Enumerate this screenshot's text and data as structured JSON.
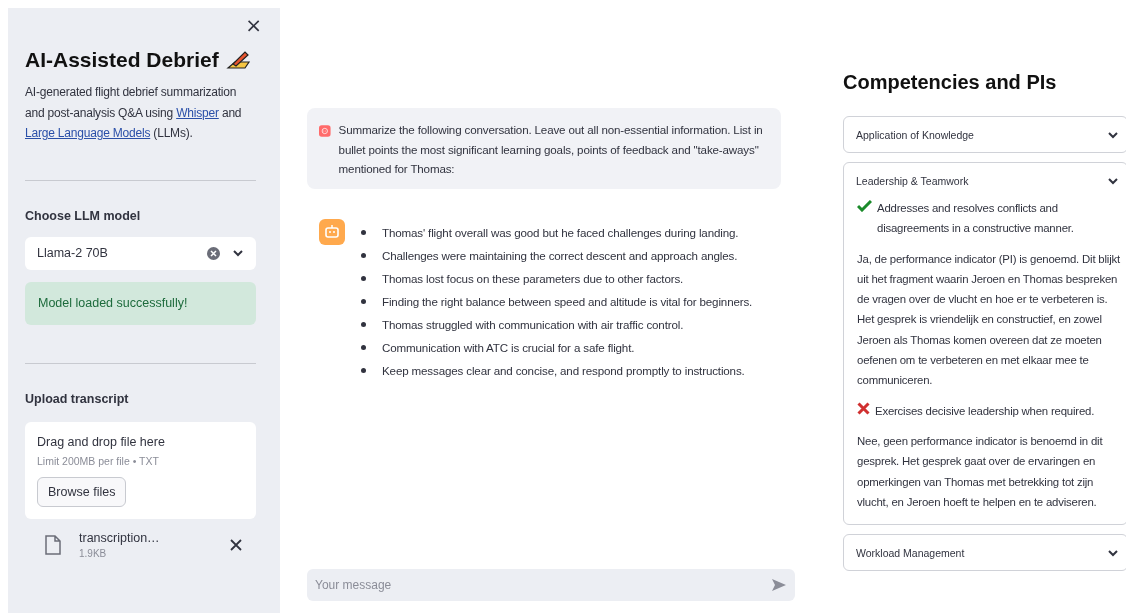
{
  "sidebar": {
    "close": "×",
    "title": "AI-Assisted Debrief",
    "description": "AI-generated flight debrief summarization and post-analysis Q&A using ",
    "links": [
      "Whisper",
      "Large Language Models"
    ],
    "description_joiner": " and ",
    "description_end": " (LLMs).",
    "model_label": "Choose LLM model",
    "model_select": {
      "value": "Llama-2 70B"
    },
    "alert": {
      "kind": "success",
      "text": "Model loaded successfully!"
    },
    "upload_label": "Upload transcript",
    "dropzone": {
      "title": "Drag and drop file here",
      "hint": "Limit 200MB per file • TXT",
      "button": "Browse files"
    },
    "file": {
      "name": "transcription…",
      "size": "1.9KB"
    }
  },
  "chat": {
    "messages": [
      {
        "kind": "user",
        "text": "Summarize the following conversation. Leave out all non-essential information. List in bullet points the most significant learning goals, points of feedback and \"take-aways\" mentioned for Thomas:"
      },
      {
        "kind": "assistant",
        "bullets": [
          "Thomas' flight overall was good but he faced challenges during landing.",
          "Challenges were maintaining the correct descent and approach angles.",
          "Thomas lost focus on these parameters due to other factors.",
          "Finding the right balance between speed and altitude is vital for beginners.",
          "Thomas struggled with communication with air traffic control.",
          "Communication with ATC is crucial for a safe flight.",
          "Keep messages clear and concise, and respond promptly to instructions."
        ]
      }
    ],
    "input": {
      "placeholder": "Your message"
    }
  },
  "competencies": {
    "title": "Competencies and PIs",
    "expanders": [
      {
        "label": "Application of Knowledge",
        "expanded": false
      },
      {
        "label": "Leadership & Teamwork",
        "expanded": true,
        "indicators": [
          {
            "met": true,
            "title": "Addresses and resolves conflicts and disagreements in a constructive manner.",
            "answer": "Ja, de performance indicator (PI) is genoemd. Dit blijkt uit het fragment waarin Jeroen en Thomas bespreken de vragen over de vlucht en hoe er te verbeteren is. Het gesprek is vriendelijk en constructief, en zowel Jeroen als Thomas komen overeen dat ze moeten oefenen om te verbeteren en met elkaar mee te communiceren."
          },
          {
            "met": false,
            "title": "Exercises decisive leadership when required.",
            "answer": "Nee, geen performance indicator is benoemd in dit gesprek. Het gesprek gaat over de ervaringen en opmerkingen van Thomas met betrekking tot zijn vlucht, en Jeroen hoeft te helpen en te adviseren."
          }
        ]
      },
      {
        "label": "Workload Management",
        "expanded": false
      }
    ]
  }
}
